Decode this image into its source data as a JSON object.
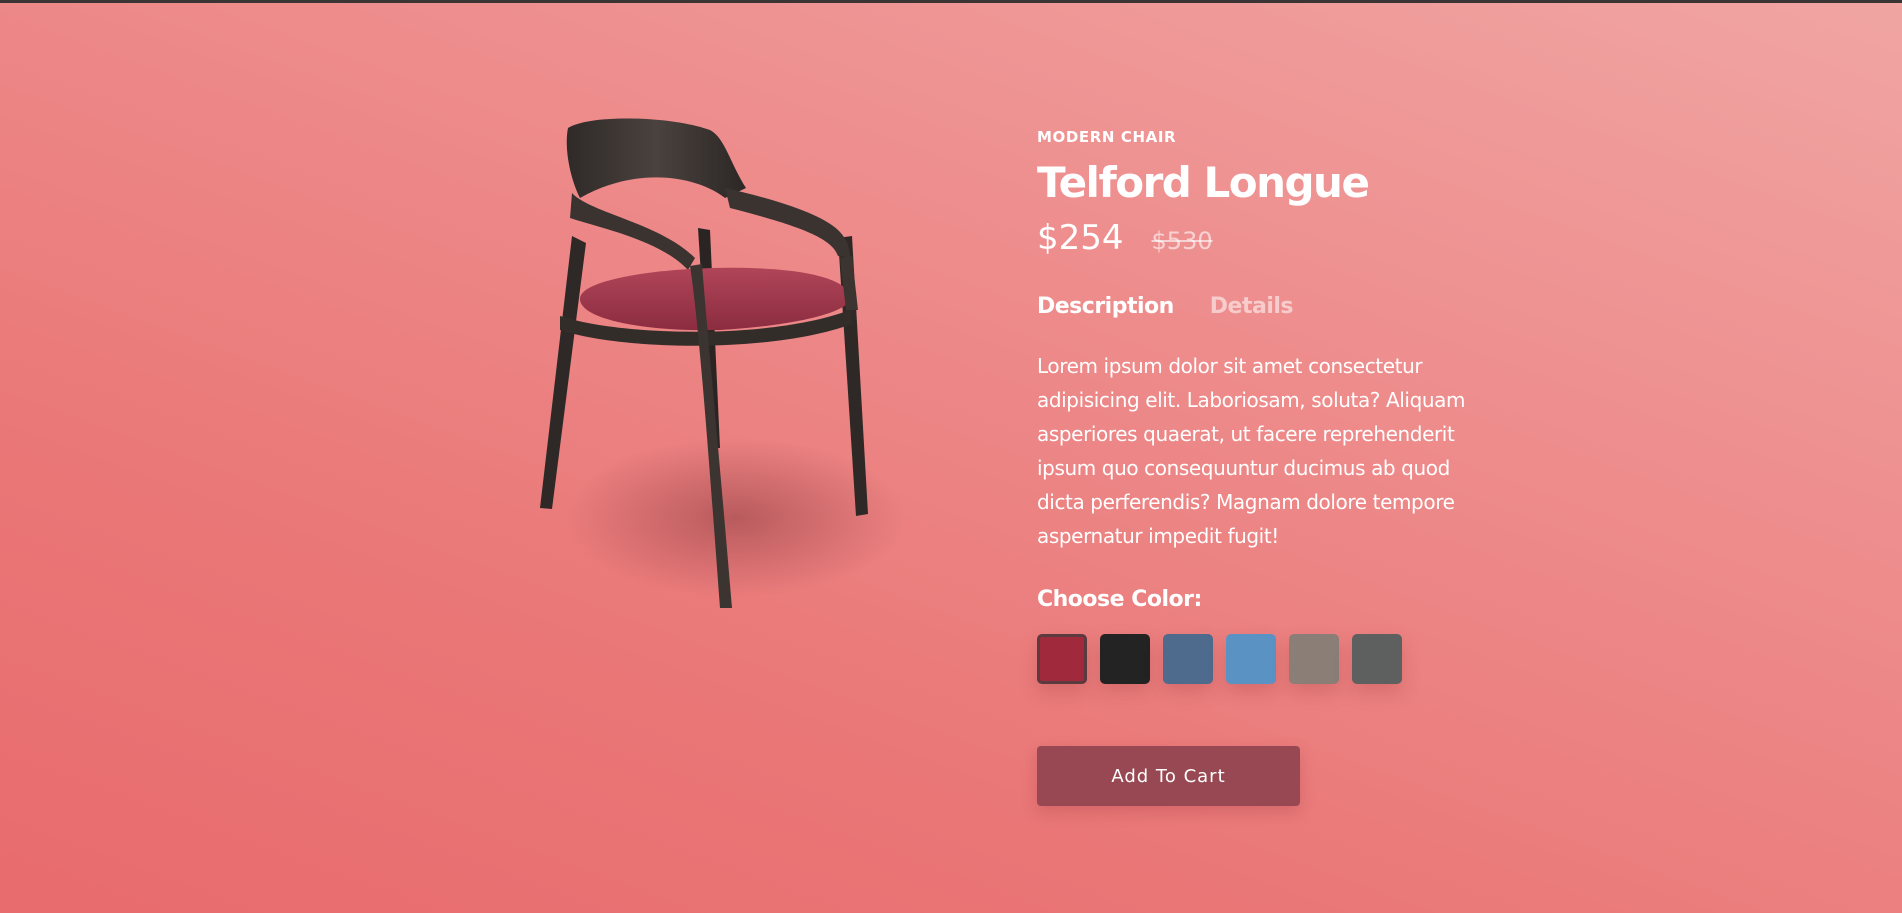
{
  "product": {
    "category": "MODERN CHAIR",
    "name": "Telford Longue",
    "price": "$254",
    "old_price": "$530"
  },
  "tabs": [
    {
      "label": "Description",
      "active": true
    },
    {
      "label": "Details",
      "active": false
    }
  ],
  "description": "Lorem ipsum dolor sit amet consectetur adipisicing elit. Laboriosam, soluta? Aliquam asperiores quaerat, ut facere reprehenderit ipsum quo consequuntur ducimus ab quod dicta perferendis? Magnam dolore tempore aspernatur impedit fugit!",
  "color_picker": {
    "label": "Choose Color:",
    "selected_index": 0,
    "swatches": [
      "#a02a3c",
      "#232323",
      "#4e6a8c",
      "#5a92c4",
      "#8a7e76",
      "#5e6060"
    ]
  },
  "cart": {
    "button_label": "Add To Cart"
  },
  "colors": {
    "background_top": "#f0a5a3",
    "background_bottom": "#e86b6d",
    "button": "#984852",
    "chair_frame": "#3a3330",
    "chair_seat": "#a83a4e"
  }
}
